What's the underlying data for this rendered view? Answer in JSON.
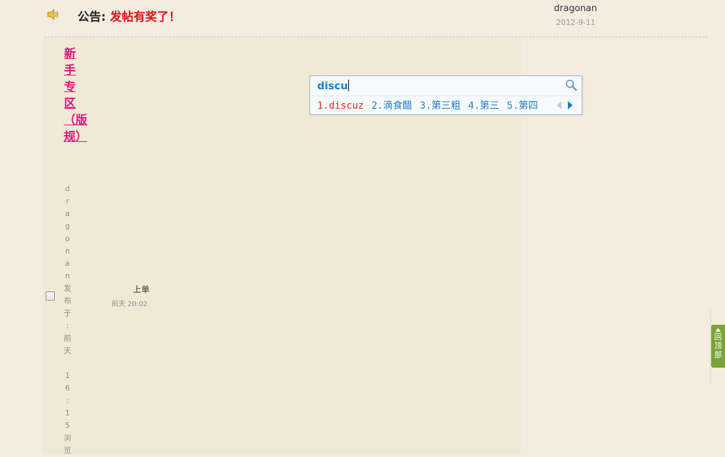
{
  "notice": {
    "label": "公告:",
    "text": "发帖有奖了！",
    "author": "dragonan",
    "date": "2012-9-11"
  },
  "thread": {
    "title_chars": [
      "新",
      "手",
      "专",
      "区",
      "（",
      "版",
      "规",
      "）"
    ],
    "meta_chars": [
      "d",
      "r",
      "a",
      "g",
      "o",
      "n",
      "a",
      "n",
      "发",
      "布",
      "于",
      ":",
      "前",
      "天",
      " ",
      "1",
      "6",
      ":",
      "1",
      "5",
      "浏",
      "览"
    ],
    "last_post_author": "上单",
    "last_post_time": "前天 20:02"
  },
  "ime": {
    "input": "discu",
    "candidates": [
      "1.discuz",
      "2.滴食醋",
      "3.第三粗",
      "4.第三",
      "5.第四"
    ],
    "selected_index": 0
  },
  "back_to_top": {
    "chars": [
      "回",
      "顶",
      "部"
    ]
  },
  "colors": {
    "background": "#f3ecdf",
    "content_background": "#efe9d6",
    "notice_link": "#e0101c",
    "thread_title": "#e0167a",
    "ime_text": "#1c7ec7",
    "ime_selected": "#e02b1a",
    "back_to_top": "#79a33a"
  }
}
